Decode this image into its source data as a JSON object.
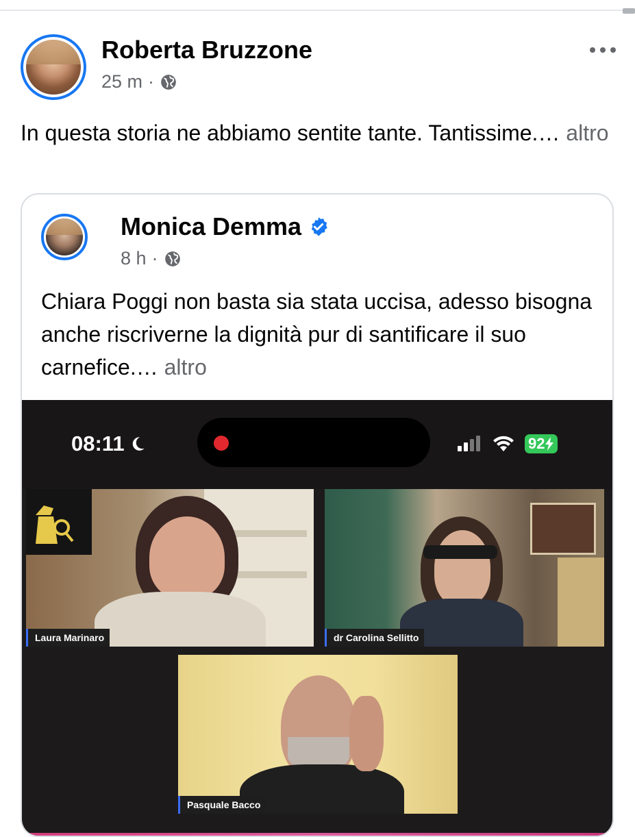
{
  "post": {
    "author": "Roberta Bruzzone",
    "time": "25 m",
    "separator": "·",
    "visibility_icon": "globe-icon",
    "text": "In questa storia ne abbiamo sentite tante. Tantissime.…",
    "more_label": "altro",
    "options_icon": "more-horizontal-icon"
  },
  "shared_post": {
    "author": "Monica Demma",
    "verified_icon": "verified-badge-icon",
    "time": "8 h",
    "separator": "·",
    "visibility_icon": "globe-icon",
    "text": "Chiara Poggi non basta sia stata uccisa, adesso bisogna anche riscriverne la dignità pur di santificare il suo carnefice.…",
    "more_label": "altro"
  },
  "video": {
    "status_time": "08:11",
    "battery": "92",
    "participants": [
      {
        "name": "Laura Marinaro"
      },
      {
        "name": "dr Carolina Sellitto"
      },
      {
        "name": "Pasquale Bacco"
      }
    ]
  },
  "colors": {
    "accent": "#1877f2",
    "secondary_text": "#65676b",
    "battery_green": "#34c759",
    "recording_red": "#e0282e"
  }
}
